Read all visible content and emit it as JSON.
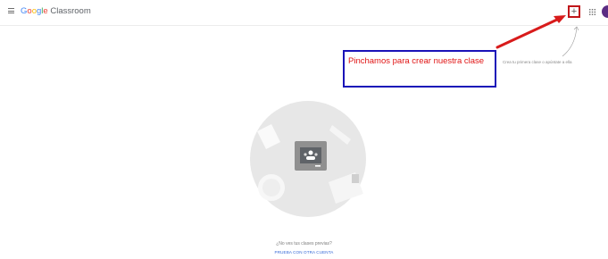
{
  "app": {
    "logo_google": "Google",
    "logo_product": "Classroom"
  },
  "header": {
    "menu_icon": "hamburger-menu-icon",
    "create_icon": "plus-icon",
    "create_label": "+",
    "apps_icon": "apps-grid-icon",
    "avatar_color": "#5b2c83"
  },
  "annotation": {
    "callout_text": "Pinchamos para crear nuestra clase",
    "callout_border_color": "#1a12b8",
    "callout_text_color": "#e01414",
    "arrow_color": "#d81b1b"
  },
  "empty_state": {
    "hint": "Crea tu primera clase o apúntate a ella",
    "question": "¿No ves tus clases previas?",
    "link_label": "PRUEBA CON OTRA CUENTA"
  }
}
